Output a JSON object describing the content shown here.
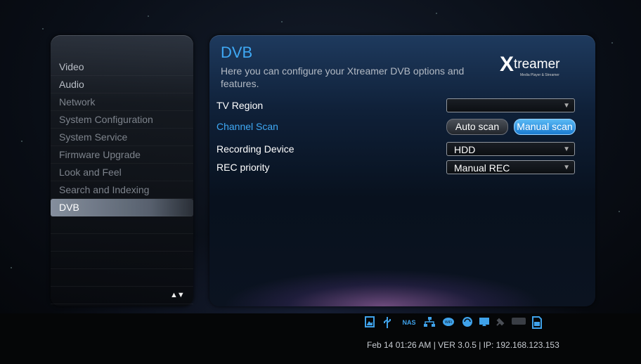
{
  "sidebar": {
    "items": [
      {
        "label": "Video"
      },
      {
        "label": "Audio"
      },
      {
        "label": "Network"
      },
      {
        "label": "System Configuration"
      },
      {
        "label": "System Service"
      },
      {
        "label": "Firmware Upgrade"
      },
      {
        "label": "Look and Feel"
      },
      {
        "label": "Search and Indexing"
      },
      {
        "label": "DVB"
      }
    ],
    "active": "DVB",
    "scroll_arrows": "▲▼"
  },
  "main": {
    "title": "DVB",
    "description": "Here you can configure your Xtreamer DVB options and features.",
    "logo": {
      "brand": "Xtreamer",
      "tagline": "Media Player & Streamer"
    },
    "rows": [
      {
        "label": "TV Region",
        "value": ""
      },
      {
        "label": "Channel Scan",
        "auto_label": "Auto scan",
        "manual_label": "Manual scan"
      },
      {
        "label": "Recording Device",
        "value": "HDD"
      },
      {
        "label": "REC priority",
        "value": "Manual REC"
      }
    ],
    "caret": "▼"
  },
  "status": {
    "icons": [
      "photo-icon",
      "usb-icon",
      "nas-icon",
      "network-icon",
      "wifi-icon",
      "sync-icon",
      "display-icon",
      "satellite-icon",
      "keyboard-icon",
      "sd-card-icon"
    ],
    "nas_label": "NAS",
    "text": "Feb 14 01:26 AM | VER 3.0.5 | IP: 192.168.123.153"
  },
  "colors": {
    "accent": "#3fa9f5",
    "active_menu": "#8c96a5",
    "background": "#050607"
  }
}
